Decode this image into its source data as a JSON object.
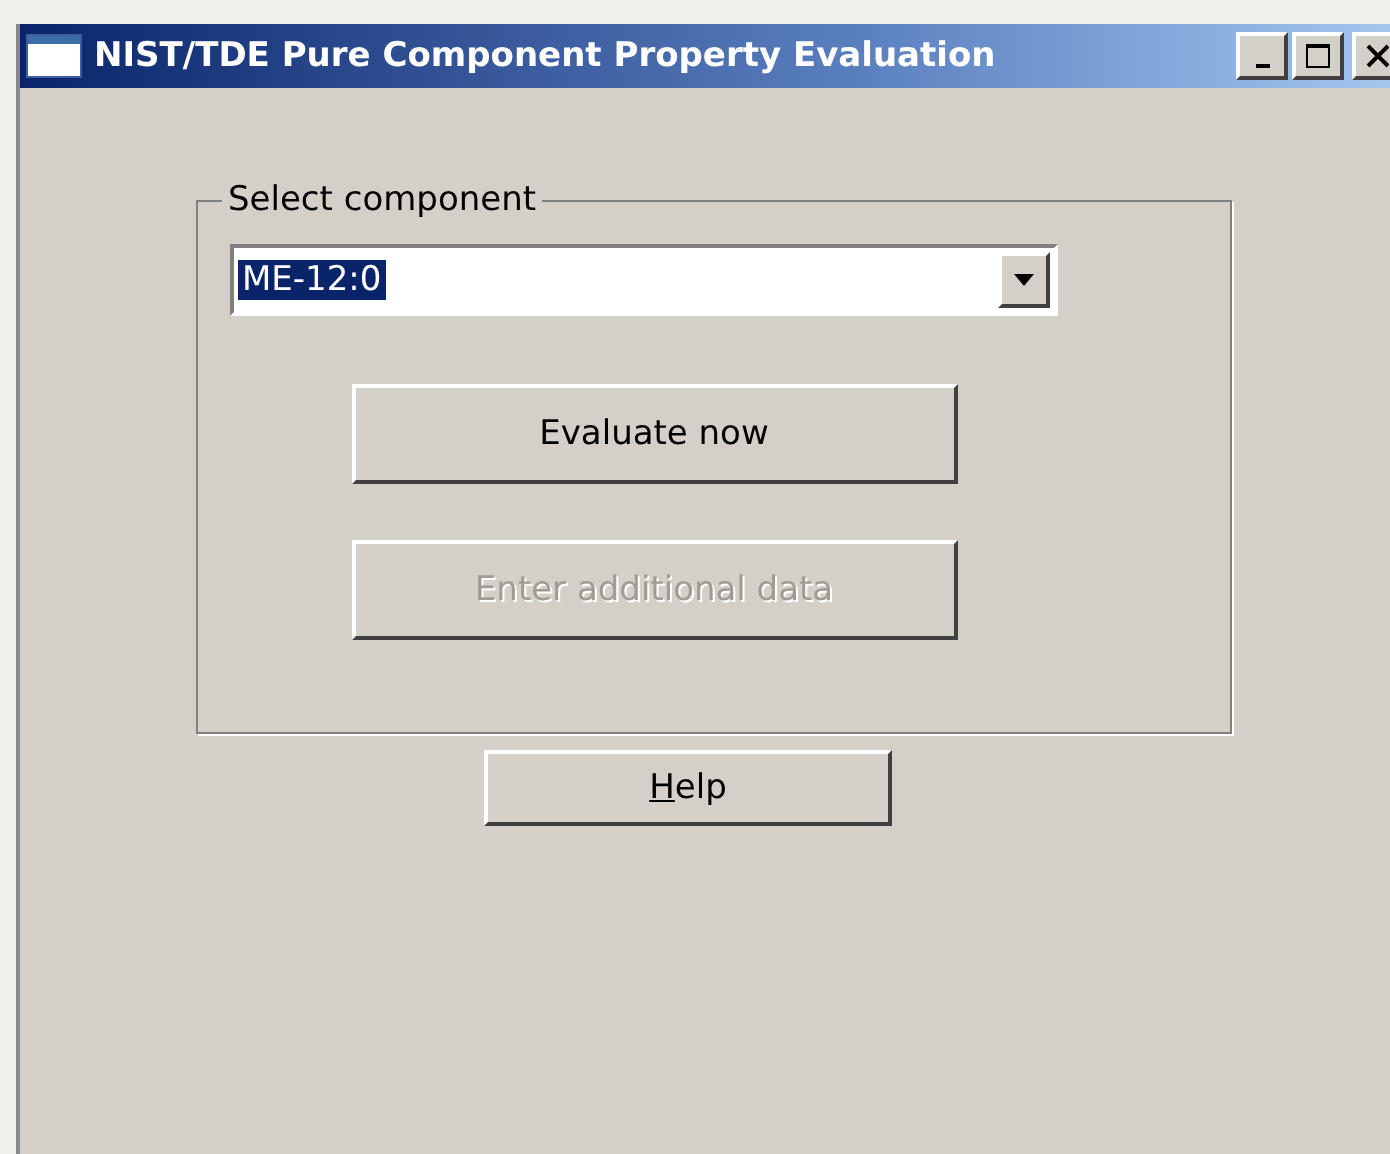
{
  "window": {
    "title": "NIST/TDE Pure Component Property Evaluation"
  },
  "group": {
    "label": "Select component",
    "combo": {
      "value": "ME-12:0",
      "selected_text": true
    },
    "buttons": [
      {
        "label": "Evaluate now",
        "disabled": false
      },
      {
        "label": "Enter additional data",
        "disabled": true
      }
    ]
  },
  "help_button": {
    "label": "Help",
    "first_letter_underlined": true,
    "disabled": false
  }
}
